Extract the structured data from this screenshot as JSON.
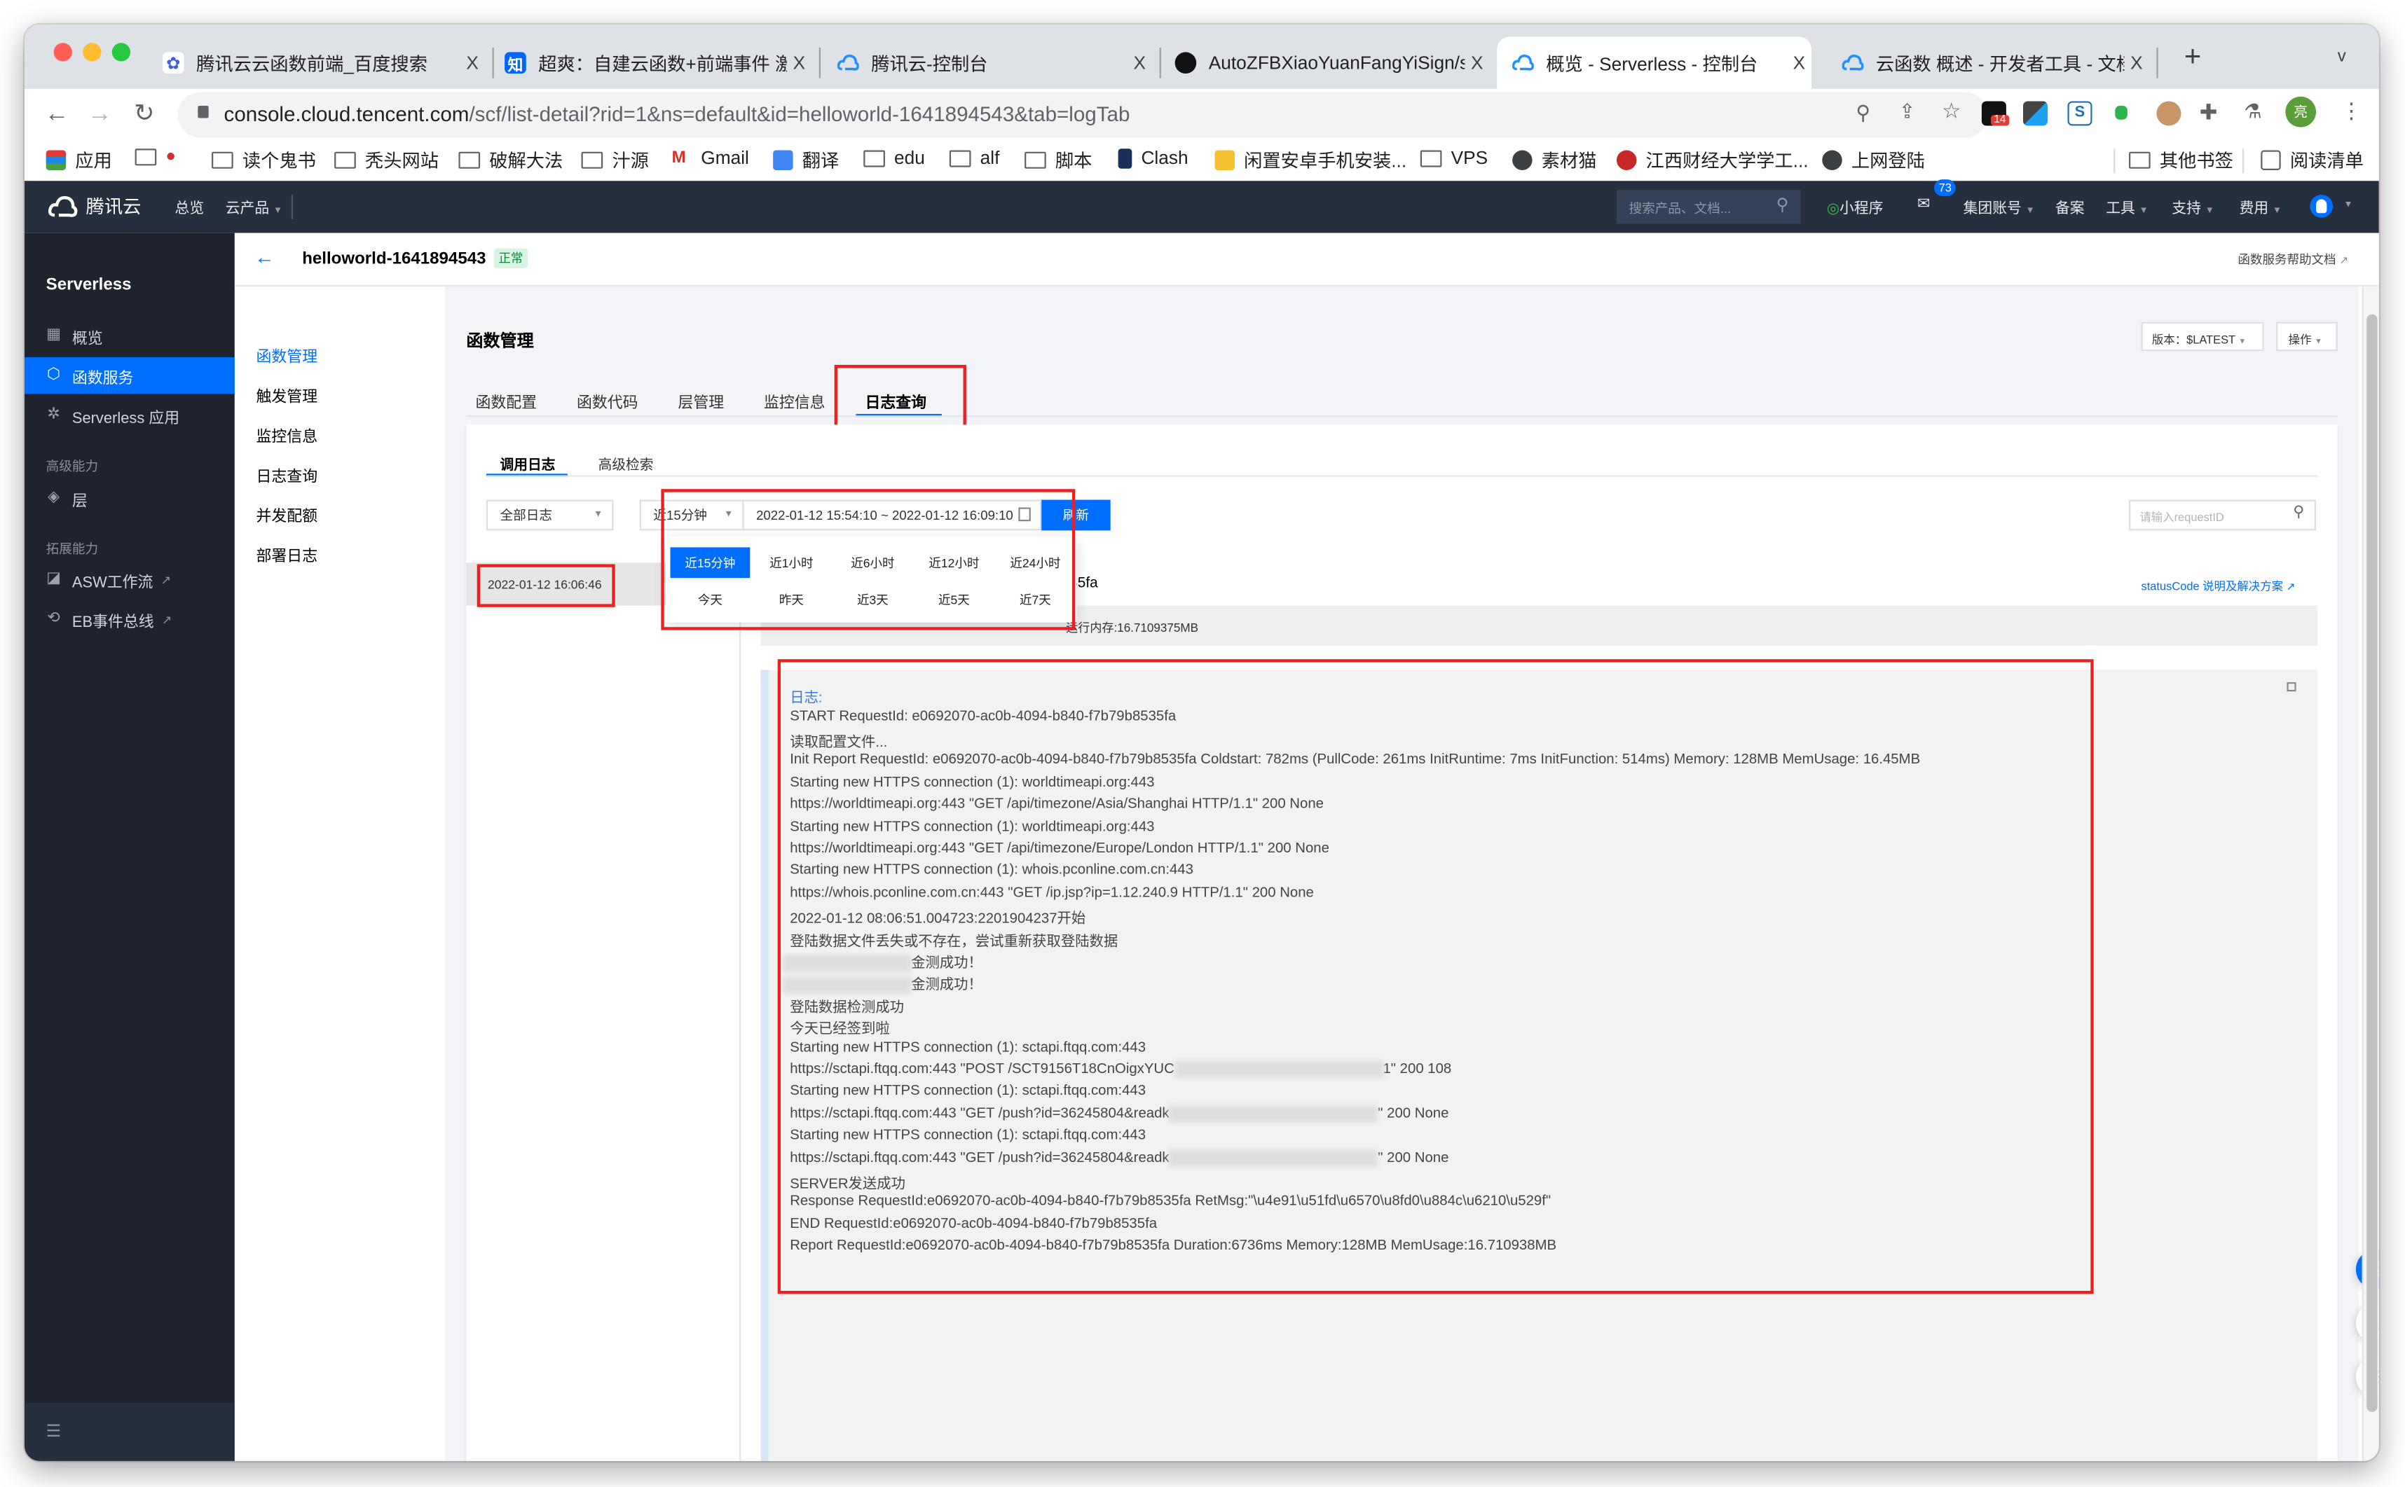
{
  "browser": {
    "tabs": [
      {
        "title": "腾讯云云函数前端_百度搜索",
        "favicon": "baidu-paw",
        "active": false
      },
      {
        "title": "超爽：自建云函数+前端事件 激活",
        "favicon": "zhihu",
        "active": false
      },
      {
        "title": "腾讯云-控制台",
        "favicon": "tencent-cloud",
        "active": false
      },
      {
        "title": "AutoZFBXiaoYuanFangYiSign/si",
        "favicon": "github",
        "active": false
      },
      {
        "title": "概览 - Serverless - 控制台",
        "favicon": "tencent-cloud",
        "active": true
      },
      {
        "title": "云函数 概述 - 开发者工具 - 文档",
        "favicon": "tencent-cloud",
        "active": false
      }
    ],
    "close_glyph": "X",
    "new_tab_glyph": "+",
    "tab_menu_glyph": "v",
    "url_host": "console.cloud.tencent.com",
    "url_path": "/scf/list-detail?rid=1&ns=default&id=helloworld-1641894543&tab=logTab",
    "extension_badge": "14",
    "profile_initial": "亮",
    "bookmarks": [
      {
        "label": "应用",
        "icon": "apps-grid"
      },
      {
        "label": "",
        "icon": "folder-apple"
      },
      {
        "label": "读个鬼书",
        "icon": "folder"
      },
      {
        "label": "秃头网站",
        "icon": "folder"
      },
      {
        "label": "破解大法",
        "icon": "folder"
      },
      {
        "label": "汁源",
        "icon": "folder"
      },
      {
        "label": "Gmail",
        "icon": "gmail"
      },
      {
        "label": "翻译",
        "icon": "google-translate"
      },
      {
        "label": "edu",
        "icon": "folder"
      },
      {
        "label": "alf",
        "icon": "folder"
      },
      {
        "label": "脚本",
        "icon": "folder"
      },
      {
        "label": "Clash",
        "icon": "clash-cat"
      },
      {
        "label": "闲置安卓手机安装...",
        "icon": "bookmark-yellow"
      },
      {
        "label": "VPS",
        "icon": "folder"
      },
      {
        "label": "素材猫",
        "icon": "globe"
      },
      {
        "label": "江西财经大学学工...",
        "icon": "university-seal"
      },
      {
        "label": "上网登陆",
        "icon": "globe"
      }
    ],
    "bookmarks_right": [
      {
        "label": "其他书签",
        "icon": "folder"
      },
      {
        "label": "阅读清单",
        "icon": "reading-list"
      }
    ]
  },
  "console_header": {
    "brand": "腾讯云",
    "nav": [
      "总览",
      "云产品"
    ],
    "search_placeholder": "搜索产品、文档...",
    "mini_program": "小程序",
    "mail_badge": "73",
    "right_nav": [
      "集团账号",
      "备案",
      "工具",
      "支持",
      "费用"
    ]
  },
  "sidebar": {
    "title": "Serverless",
    "items": [
      {
        "label": "概览",
        "icon": "grid-icon",
        "active": false
      },
      {
        "label": "函数服务",
        "icon": "function-icon",
        "active": true
      },
      {
        "label": "Serverless 应用",
        "icon": "app-icon",
        "active": false
      }
    ],
    "group_advanced": "高级能力",
    "advanced_items": [
      {
        "label": "层",
        "icon": "layers-icon"
      }
    ],
    "group_extend": "拓展能力",
    "extend_items": [
      {
        "label": "ASW工作流",
        "icon": "workflow-icon",
        "external": true
      },
      {
        "label": "EB事件总线",
        "icon": "event-bus-icon",
        "external": true
      }
    ]
  },
  "function_header": {
    "name": "helloworld-1641894543",
    "status": "正常",
    "help_link": "函数服务帮助文档"
  },
  "subnav": {
    "items": [
      "函数管理",
      "触发管理",
      "监控信息",
      "日志查询",
      "并发配额",
      "部署日志"
    ],
    "active": "函数管理"
  },
  "main": {
    "title": "函数管理",
    "version_label": "版本：$LATEST",
    "action_label": "操作",
    "tabs": [
      "函数配置",
      "函数代码",
      "层管理",
      "监控信息",
      "日志查询"
    ],
    "active_tab": "日志查询",
    "log_tabs": [
      "调用日志",
      "高级检索"
    ],
    "active_log_tab": "调用日志",
    "log_type_select": "全部日志",
    "time_range_select": "近15分钟",
    "time_range_value": "2022-01-12 15:54:10 ~ 2022-01-12 16:09:10",
    "refresh_label": "刷新",
    "request_id_placeholder": "请输入requestID",
    "time_presets": [
      "近15分钟",
      "近1小时",
      "近6小时",
      "近12小时",
      "近24小时",
      "今天",
      "昨天",
      "近3天",
      "近5天",
      "近7天"
    ],
    "selected_preset": "近15分钟",
    "invocation_list": [
      "2022-01-12 16:06:46"
    ],
    "request_id_tail": "535fa",
    "status_code_link": "statusCode 说明及解决方案",
    "run_memory": "运行内存:16.7109375MB",
    "log_label": "日志:",
    "log_lines": [
      "START RequestId: e0692070-ac0b-4094-b840-f7b79b8535fa",
      "读取配置文件...",
      "Init Report RequestId: e0692070-ac0b-4094-b840-f7b79b8535fa Coldstart: 782ms (PullCode: 261ms InitRuntime: 7ms InitFunction: 514ms) Memory: 128MB MemUsage: 16.45MB",
      "Starting new HTTPS connection (1): worldtimeapi.org:443",
      "https://worldtimeapi.org:443 \"GET /api/timezone/Asia/Shanghai HTTP/1.1\" 200 None",
      "Starting new HTTPS connection (1): worldtimeapi.org:443",
      "https://worldtimeapi.org:443 \"GET /api/timezone/Europe/London HTTP/1.1\" 200 None",
      "Starting new HTTPS connection (1): whois.pconline.com.cn:443",
      "https://whois.pconline.com.cn:443 \"GET /ip.jsp?ip=1.12.240.9 HTTP/1.1\" 200 None",
      "2022-01-12 08:06:51.004723:2201904237开始",
      "登陆数据文件丢失或不存在，尝试重新获取登陆数据",
      "[redacted]金测成功！",
      "[redacted]金测成功！",
      "登陆数据检测成功",
      "今天已经签到啦",
      "Starting new HTTPS connection (1): sctapi.ftqq.com:443",
      "https://sctapi.ftqq.com:443 \"POST /SCT9156T18CnOigxYUC[redacted]1\" 200 108",
      "Starting new HTTPS connection (1): sctapi.ftqq.com:443",
      "https://sctapi.ftqq.com:443 \"GET /push?id=36245804&readk[redacted]\" 200 None",
      "Starting new HTTPS connection (1): sctapi.ftqq.com:443",
      "https://sctapi.ftqq.com:443 \"GET /push?id=36245804&readk[redacted]\" 200 None",
      "SERVER发送成功",
      "Response RequestId:e0692070-ac0b-4094-b840-f7b79b8535fa RetMsg:\"\\u4e91\\u51fd\\u6570\\u8fd0\\u884c\\u6210\\u529f\"",
      "END RequestId:e0692070-ac0b-4094-b840-f7b79b8535fa",
      "Report RequestId:e0692070-ac0b-4094-b840-f7b79b8535fa Duration:6736ms Memory:128MB MemUsage:16.710938MB"
    ],
    "log_segments": {
      "l11_tail": "金测成功！",
      "l16_head": "https://sctapi.ftqq.com:443 \"POST /SCT9156T18CnOigxYUC",
      "l16_tail": "1\" 200 108",
      "l18_head": "https://sctapi.ftqq.com:443 \"GET /push?id=36245804&readk",
      "l18_tail": "\" 200 None"
    }
  },
  "colors": {
    "brand_blue": "#006eff",
    "header_bg": "#262f3e",
    "sidebar_bg": "#1f232d",
    "annotation_red": "#ee1f1f",
    "status_green": "#0abf5b"
  }
}
